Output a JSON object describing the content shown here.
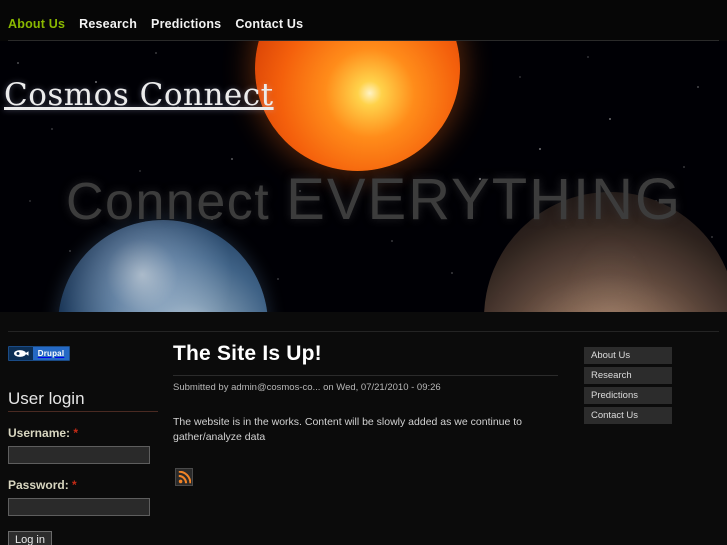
{
  "site": {
    "name": "Cosmos Connect",
    "tagline_lead": "Connect",
    "tagline_emph": "EVERYTHING"
  },
  "topnav": {
    "items": [
      {
        "label": "About Us",
        "active": true
      },
      {
        "label": "Research",
        "active": false
      },
      {
        "label": "Predictions",
        "active": false
      },
      {
        "label": "Contact Us",
        "active": false
      }
    ]
  },
  "sidebar_left": {
    "badge": {
      "name": "Drupal",
      "icon": "drupal-drop-icon"
    },
    "login_block": {
      "title": "User login",
      "username": {
        "label": "Username:",
        "required_mark": "*",
        "value": "",
        "placeholder": ""
      },
      "password": {
        "label": "Password:",
        "required_mark": "*",
        "value": "",
        "placeholder": ""
      },
      "submit_label": "Log in"
    }
  },
  "content": {
    "node": {
      "title": "The Site Is Up!",
      "submitted": "Submitted by admin@cosmos-co... on Wed, 07/21/2010 - 09:26",
      "body": "The website is in the works. Content will be slowly added as we continue to gather/analyze data",
      "feed_icon": "rss-feed-icon"
    }
  },
  "sidebar_right": {
    "menu": [
      {
        "label": "About Us"
      },
      {
        "label": "Research"
      },
      {
        "label": "Predictions"
      },
      {
        "label": "Contact Us"
      }
    ]
  },
  "colors": {
    "nav_active": "#8ab800",
    "nav_text": "#f2f2f2",
    "page_bg": "#0b0b0b",
    "required": "#c62b16",
    "drupal_blue": "#2569c4",
    "rss_orange": "#f18326",
    "sun_orange": "#ff8c1a"
  }
}
